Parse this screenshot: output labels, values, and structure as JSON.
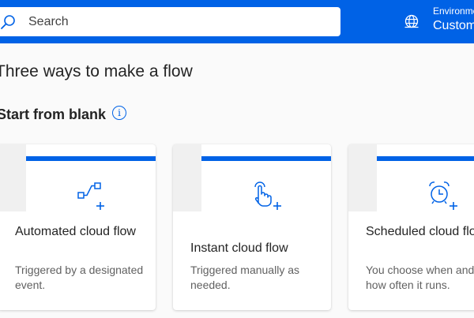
{
  "header": {
    "search": {
      "placeholder": "Search",
      "value": ""
    },
    "environment": {
      "label": "Environments",
      "name": "Customer Service"
    }
  },
  "page_title": "Three ways to make a flow",
  "section_title": "Start from blank",
  "info_glyph": "i",
  "cards": [
    {
      "title": "Automated cloud flow",
      "description": "Triggered by a designated event.",
      "icon": "automated-flow-icon"
    },
    {
      "title": "Instant cloud flow",
      "description": "Triggered manually as needed.",
      "icon": "instant-flow-icon"
    },
    {
      "title": "Scheduled cloud flow",
      "description": "You choose when and how often it runs.",
      "icon": "scheduled-flow-icon"
    }
  ],
  "colors": {
    "accent": "#0062e6",
    "card_bg": "#ffffff",
    "page_bg": "#fafafa"
  }
}
